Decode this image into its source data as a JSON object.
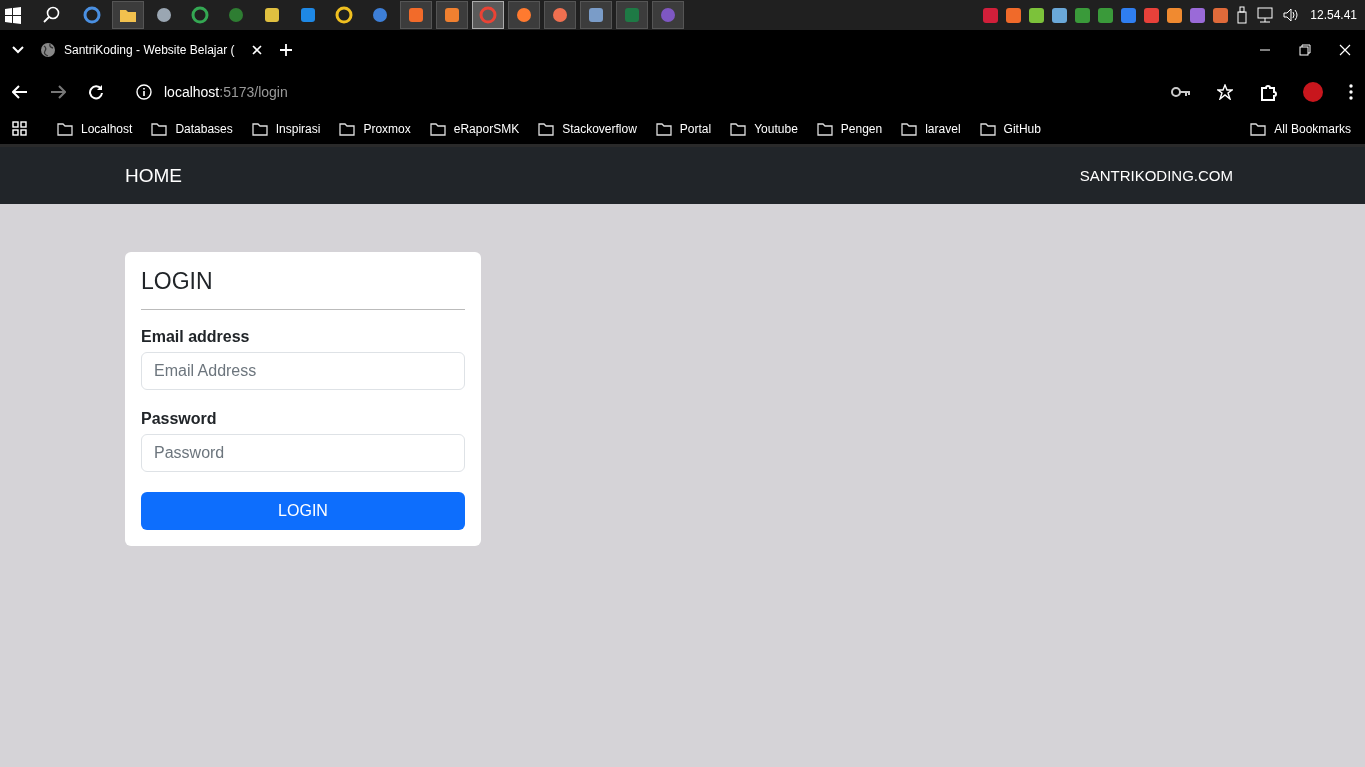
{
  "taskbar": {
    "apps": [
      {
        "kind": "ring",
        "color": "#4a90e2",
        "running": false
      },
      {
        "kind": "folder",
        "color": "#f2c14e",
        "running": true
      },
      {
        "kind": "dot",
        "color": "#9aa6b2",
        "running": false
      },
      {
        "kind": "ring",
        "color": "#34a853",
        "running": false
      },
      {
        "kind": "dot",
        "color": "#2e7d32",
        "running": false
      },
      {
        "kind": "square",
        "color": "#e0c040",
        "running": false
      },
      {
        "kind": "square",
        "color": "#1e88e5",
        "running": false
      },
      {
        "kind": "ring",
        "color": "#f0c020",
        "running": false
      },
      {
        "kind": "dot",
        "color": "#3d7fd8",
        "running": false
      },
      {
        "kind": "square",
        "color": "#f26b2a",
        "running": true
      },
      {
        "kind": "square",
        "color": "#f08030",
        "running": true
      },
      {
        "kind": "ring",
        "color": "#ea4335",
        "running": true,
        "selected": true
      },
      {
        "kind": "dot",
        "color": "#ff7a2f",
        "running": true
      },
      {
        "kind": "dot",
        "color": "#f07050",
        "running": true
      },
      {
        "kind": "square",
        "color": "#7a9cc8",
        "running": true
      },
      {
        "kind": "square",
        "color": "#1e7a45",
        "running": true
      },
      {
        "kind": "dot",
        "color": "#7e57c2",
        "running": true
      }
    ],
    "tray": [
      {
        "color": "#d11f3a"
      },
      {
        "color": "#f06a2a"
      },
      {
        "color": "#7cc23a"
      },
      {
        "color": "#6aa8d8"
      },
      {
        "color": "#3a9a3a"
      },
      {
        "color": "#3a9a3a"
      },
      {
        "color": "#2f7ef0"
      },
      {
        "color": "#e8413a"
      },
      {
        "color": "#f08a30"
      },
      {
        "color": "#9a6ad8"
      },
      {
        "color": "#e06a3a"
      }
    ],
    "clock": "12.54.41"
  },
  "browser": {
    "tab": {
      "title": "SantriKoding - Website Belajar ("
    },
    "url_host": "localhost",
    "url_path": ":5173/login",
    "bookmarks": [
      {
        "label": "Localhost"
      },
      {
        "label": "Databases"
      },
      {
        "label": "Inspirasi"
      },
      {
        "label": "Proxmox"
      },
      {
        "label": "eRaporSMK"
      },
      {
        "label": "Stackoverflow"
      },
      {
        "label": "Portal"
      },
      {
        "label": "Youtube"
      },
      {
        "label": "Pengen"
      },
      {
        "label": "laravel"
      },
      {
        "label": "GitHub"
      }
    ],
    "all_bookmarks": "All Bookmarks"
  },
  "navbar": {
    "home": "HOME",
    "brand": "SANTRIKODING.COM"
  },
  "login": {
    "title": "LOGIN",
    "fields": [
      {
        "label": "Email address",
        "placeholder": "Email Address"
      },
      {
        "label": "Password",
        "placeholder": "Password"
      }
    ],
    "button": "LOGIN"
  }
}
